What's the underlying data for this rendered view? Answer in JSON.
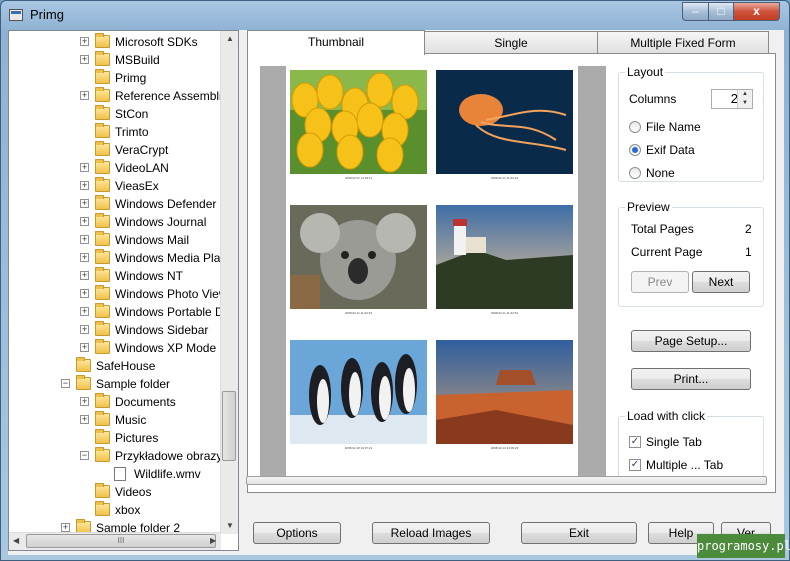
{
  "window": {
    "title": "Primg",
    "min_glyph": "–",
    "max_glyph": "□",
    "close_glyph": "x"
  },
  "tree": {
    "items": [
      {
        "label": "Microsoft SDKs",
        "level": 2,
        "expander": "+",
        "icon": "folder"
      },
      {
        "label": "MSBuild",
        "level": 2,
        "expander": "+",
        "icon": "folder"
      },
      {
        "label": "Primg",
        "level": 2,
        "expander": "",
        "icon": "folder"
      },
      {
        "label": "Reference Assemblies",
        "level": 2,
        "expander": "+",
        "icon": "folder"
      },
      {
        "label": "StCon",
        "level": 2,
        "expander": "",
        "icon": "folder"
      },
      {
        "label": "Trimto",
        "level": 2,
        "expander": "",
        "icon": "folder"
      },
      {
        "label": "VeraCrypt",
        "level": 2,
        "expander": "",
        "icon": "folder"
      },
      {
        "label": "VideoLAN",
        "level": 2,
        "expander": "+",
        "icon": "folder"
      },
      {
        "label": "VieasEx",
        "level": 2,
        "expander": "+",
        "icon": "folder"
      },
      {
        "label": "Windows Defender",
        "level": 2,
        "expander": "+",
        "icon": "folder"
      },
      {
        "label": "Windows Journal",
        "level": 2,
        "expander": "+",
        "icon": "folder"
      },
      {
        "label": "Windows Mail",
        "level": 2,
        "expander": "+",
        "icon": "folder"
      },
      {
        "label": "Windows Media Player",
        "level": 2,
        "expander": "+",
        "icon": "folder"
      },
      {
        "label": "Windows NT",
        "level": 2,
        "expander": "+",
        "icon": "folder"
      },
      {
        "label": "Windows Photo Viewer",
        "level": 2,
        "expander": "+",
        "icon": "folder"
      },
      {
        "label": "Windows Portable Devices",
        "level": 2,
        "expander": "+",
        "icon": "folder"
      },
      {
        "label": "Windows Sidebar",
        "level": 2,
        "expander": "+",
        "icon": "folder"
      },
      {
        "label": "Windows XP Mode",
        "level": 2,
        "expander": "+",
        "icon": "folder"
      },
      {
        "label": "SafeHouse",
        "level": 1,
        "expander": "",
        "icon": "folder"
      },
      {
        "label": "Sample folder",
        "level": 1,
        "expander": "−",
        "icon": "folder"
      },
      {
        "label": "Documents",
        "level": 2,
        "expander": "+",
        "icon": "folder"
      },
      {
        "label": "Music",
        "level": 2,
        "expander": "+",
        "icon": "folder"
      },
      {
        "label": "Pictures",
        "level": 2,
        "expander": "",
        "icon": "folder"
      },
      {
        "label": "Przykładowe obrazy",
        "level": 2,
        "expander": "−",
        "icon": "folder"
      },
      {
        "label": "Wildlife.wmv",
        "level": 3,
        "expander": "",
        "icon": "file"
      },
      {
        "label": "Videos",
        "level": 2,
        "expander": "",
        "icon": "folder"
      },
      {
        "label": "xbox",
        "level": 2,
        "expander": "",
        "icon": "folder"
      },
      {
        "label": "Sample folder 2",
        "level": 1,
        "expander": "+",
        "icon": "folder"
      }
    ],
    "hscroll_grip": "III"
  },
  "tabs": [
    {
      "label": "Thumbnail",
      "active": true
    },
    {
      "label": "Single",
      "active": false
    },
    {
      "label": "Multiple Fixed Form",
      "active": false
    }
  ],
  "thumbnails": [
    {
      "caption": "2008.02.07 11:33:11",
      "subject": "tulips"
    },
    {
      "caption": "2008.02.11 11:32:24",
      "subject": "jellyfish"
    },
    {
      "caption": "2008.02.11 11:32:43",
      "subject": "koala"
    },
    {
      "caption": "2008.02.11 11:32:51",
      "subject": "lighthouse"
    },
    {
      "caption": "2008.02.18 16:37:21",
      "subject": "penguins"
    },
    {
      "caption": "2008.02.14 13:36:26",
      "subject": "desert"
    }
  ],
  "layout": {
    "title": "Layout",
    "columns_label": "Columns",
    "columns_value": "2",
    "options": [
      {
        "label": "File Name",
        "selected": false
      },
      {
        "label": "Exif Data",
        "selected": true
      },
      {
        "label": "None",
        "selected": false
      }
    ]
  },
  "preview": {
    "title": "Preview",
    "total_pages_label": "Total Pages",
    "total_pages_value": "2",
    "current_page_label": "Current Page",
    "current_page_value": "1",
    "prev_label": "Prev",
    "next_label": "Next"
  },
  "page_setup_label": "Page Setup...",
  "print_label": "Print...",
  "load_with_click": {
    "title": "Load with click",
    "options": [
      {
        "label": "Single Tab",
        "checked": true
      },
      {
        "label": "Multiple ... Tab",
        "checked": true
      }
    ]
  },
  "bottom_buttons": {
    "options": "Options",
    "reload": "Reload Images",
    "exit": "Exit",
    "help": "Help",
    "ver": "Ver"
  },
  "watermark": "programosy.pl"
}
